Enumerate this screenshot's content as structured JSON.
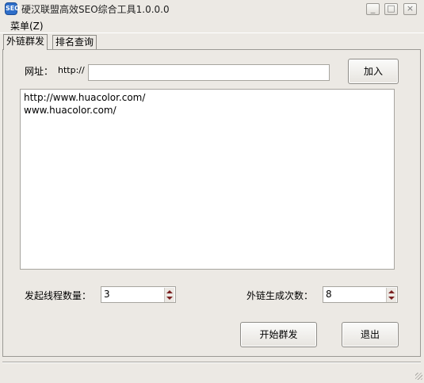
{
  "window": {
    "title": "硬汉联盟高效SEO综合工具1.0.0.0",
    "icon": "app-logo-icon",
    "controls": {
      "minimize": "_",
      "maximize": "□",
      "close": "×"
    }
  },
  "menu": {
    "items": [
      {
        "label": "菜单(Z)"
      }
    ]
  },
  "tabs": [
    {
      "label": "外链群发",
      "active": true
    },
    {
      "label": "排名查询",
      "active": false
    }
  ],
  "url_row": {
    "label": "网址：",
    "prefix": "http://",
    "value": "",
    "add_button": "加入"
  },
  "url_list": [
    "http://www.huacolor.com/",
    "www.huacolor.com/"
  ],
  "threads": {
    "label": "发起线程数量：",
    "value": "3"
  },
  "link_count": {
    "label": "外链生成次数：",
    "value": "8"
  },
  "actions": {
    "start": "开始群发",
    "exit": "退出"
  }
}
